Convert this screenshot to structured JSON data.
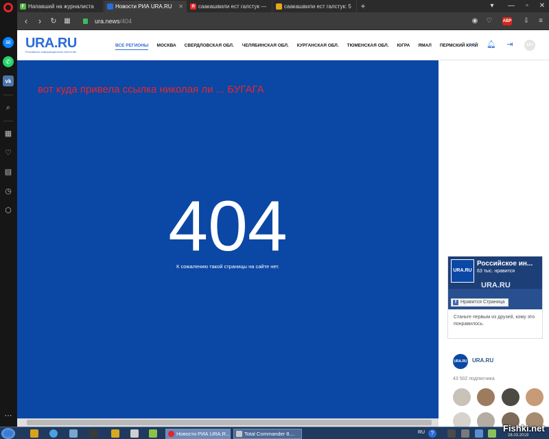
{
  "tabs": [
    {
      "label": "Напавший на журналиста",
      "active": false
    },
    {
      "label": "Новости РИА URA.RU",
      "active": true
    },
    {
      "label": "саакашвили ест галстук —",
      "active": false
    },
    {
      "label": "саакашвили ест галстук: 5",
      "active": false
    }
  ],
  "address": {
    "host": "ura.news",
    "path": "/404"
  },
  "extensions": {
    "abp_badge": "ABP"
  },
  "site": {
    "logo": "URA.RU",
    "logo_sub": "Российское информационное агентство",
    "regions": [
      "ВСЕ РЕГИОНЫ",
      "МОСКВА",
      "СВЕРДЛОВСКАЯ ОБЛ.",
      "ЧЕЛЯБИНСКАЯ ОБЛ.",
      "КУРГАНСКАЯ ОБЛ.",
      "ТЮМЕНСКАЯ ОБЛ.",
      "ЮГРА",
      "ЯМАЛ",
      "ПЕРМСКИЙ КРАЙ"
    ],
    "age_rating": "18+"
  },
  "error": {
    "annotation": "вот куда привела  ссылка николая ли ... БУГАГА",
    "code": "404",
    "message": "К сожалению такой страницы на сайте нет."
  },
  "fb_widget": {
    "page_name": "Российское ин...",
    "likes": "63 тыс. нравится",
    "thumb_text": "URA.RU",
    "cover_text": "URA.RU",
    "like_button": "Нравится Страница",
    "cta": "Станьте первым из друзей, кому это понравилось."
  },
  "vk_widget": {
    "name": "URA.RU",
    "avatar_text": "URA.RU",
    "subscribers": "43 502 подписчика"
  },
  "taskbar": {
    "tasks": [
      {
        "label": "Новости РИА URA.R...",
        "active": true
      },
      {
        "label": "Total Commander 8....",
        "active": false
      }
    ],
    "lang": "RU",
    "watermark": "Fishki.net",
    "date": "28.03.2019"
  },
  "colors": {
    "brand": "#2b6cd9",
    "error_bg": "#0b47a5",
    "annotation": "#e8282b"
  }
}
